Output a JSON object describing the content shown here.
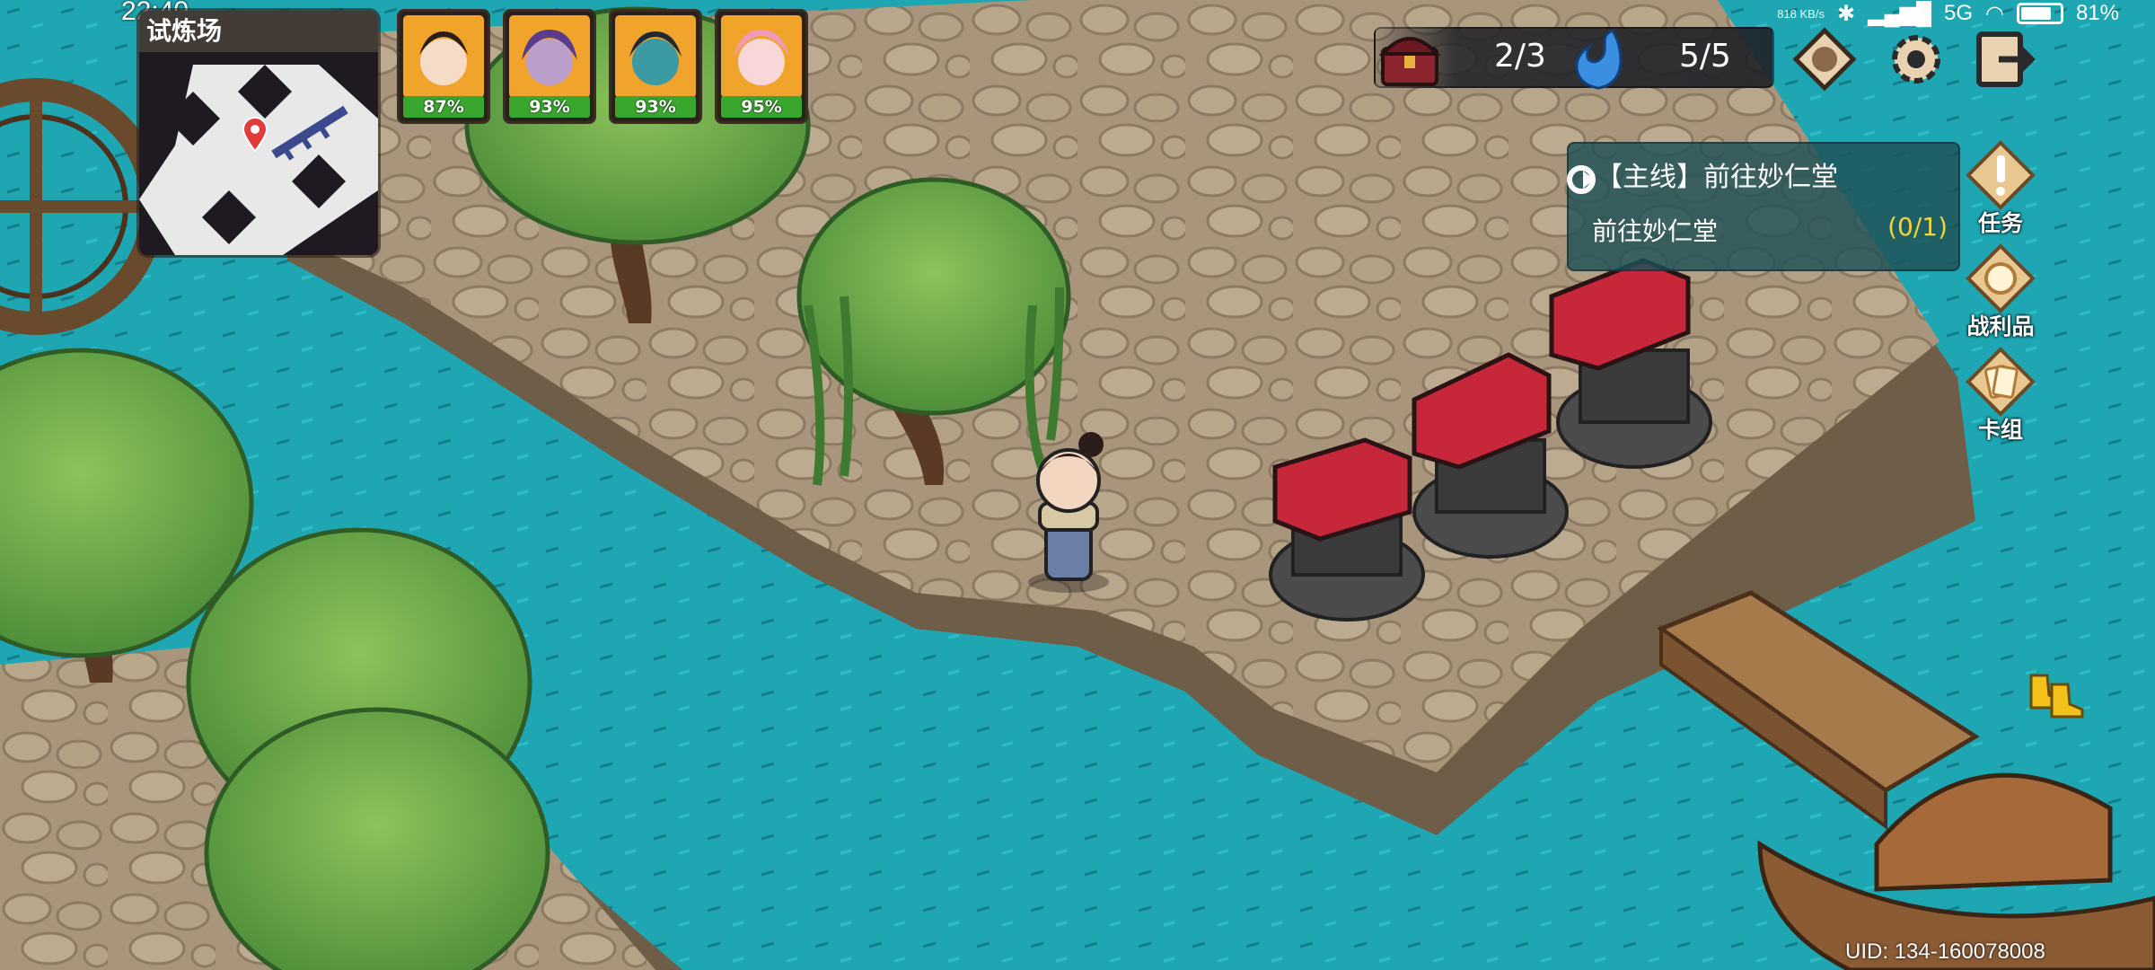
{
  "status": {
    "time": "22:40",
    "net_speed": "818 KB/s",
    "signal": "5G",
    "battery": "81%",
    "battery_level": 0.81
  },
  "minimap": {
    "title": "试炼场"
  },
  "party": [
    {
      "hp": "87%",
      "color": "#f0a020"
    },
    {
      "hp": "93%",
      "color": "#f0a020"
    },
    {
      "hp": "93%",
      "color": "#f0a020"
    },
    {
      "hp": "95%",
      "color": "#f0a020"
    }
  ],
  "resources": {
    "chest": "2/3",
    "energy": "5/5"
  },
  "top_buttons": [
    "map-icon",
    "settings-icon",
    "exit-icon"
  ],
  "quest": {
    "title": "【主线】前往妙仁堂",
    "objective": "前往妙仁堂",
    "progress": "(0/1)"
  },
  "side_menu": {
    "tasks": "任务",
    "loot": "战利品",
    "deck": "卡组"
  },
  "uid": "UID: 134-160078008"
}
